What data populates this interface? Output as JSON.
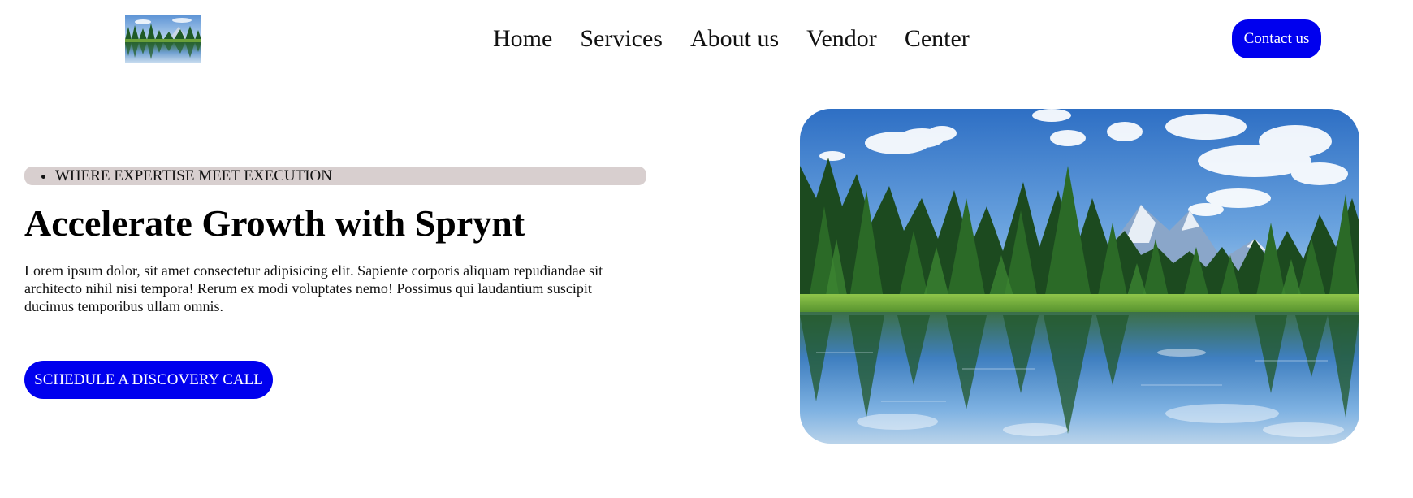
{
  "header": {
    "logo": {
      "icon": "landscape-thumbnail-logo"
    },
    "nav": {
      "items": [
        {
          "label": "Home"
        },
        {
          "label": "Services"
        },
        {
          "label": "About us"
        },
        {
          "label": "Vendor"
        },
        {
          "label": "Center"
        }
      ]
    },
    "contact_button": {
      "label": "Contact us"
    }
  },
  "hero": {
    "tagline": "WHERE EXPERTISE MEET EXECUTION",
    "title": "Accelerate Growth with Sprynt",
    "description": "Lorem ipsum dolor, sit amet consectetur adipisicing elit. Sapiente corporis aliquam repudiandae sit architecto nihil nisi tempora! Rerum ex modi voluptates nemo! Possimus qui laudantium suscipit ducimus temporibus ullam omnis.",
    "cta_button": {
      "label": "SCHEDULE A DISCOVERY CALL"
    },
    "image": {
      "icon": "lake-forest-landscape-image"
    }
  },
  "colors": {
    "primary_button": "#0000ee",
    "tag_background": "#d8cfcf",
    "page_background": "#ffffff"
  }
}
